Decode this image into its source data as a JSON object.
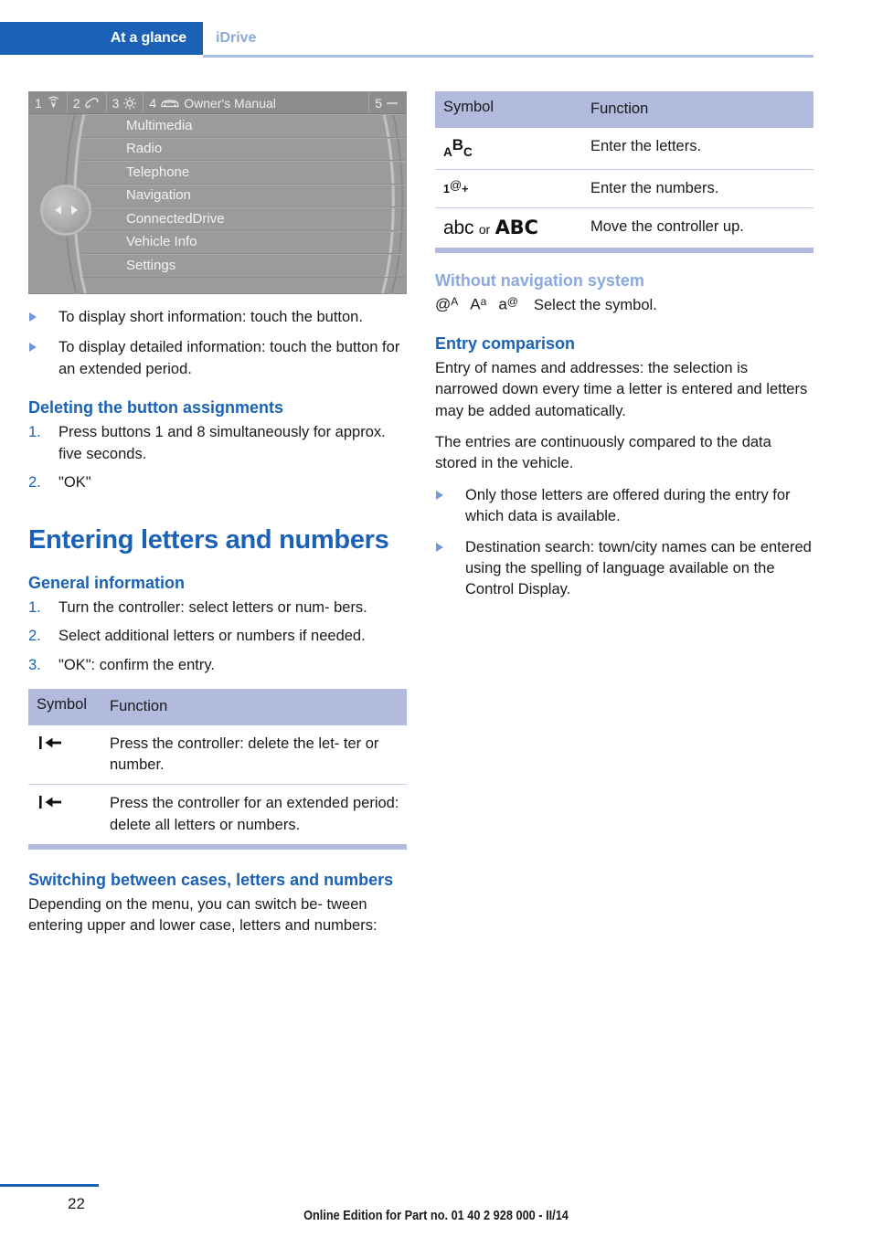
{
  "header": {
    "active_tab": "At a glance",
    "sub_tab": "iDrive"
  },
  "idrive_screenshot": {
    "top_bar": [
      {
        "number": "1",
        "icon": "radio-waves-icon"
      },
      {
        "number": "2",
        "icon": "telephone-handset-icon"
      },
      {
        "number": "3",
        "icon": "gear-icon"
      },
      {
        "number": "4",
        "icon": "car-front-icon",
        "label": "Owner's Manual"
      },
      {
        "number": "5",
        "icon": "minus-icon"
      }
    ],
    "menu_items": [
      "Multimedia",
      "Radio",
      "Telephone",
      "Navigation",
      "ConnectedDrive",
      "Vehicle Info",
      "Settings"
    ]
  },
  "left_column": {
    "bullets_top": [
      "To display short information: touch the button.",
      "To display detailed information: touch the button for an extended period."
    ],
    "deleting_heading": "Deleting the button assignments",
    "deleting_steps": [
      {
        "num": "1.",
        "text": "Press buttons 1 and 8 simultaneously for approx. five seconds."
      },
      {
        "num": "2.",
        "text": "\"OK\""
      }
    ],
    "main_heading": "Entering letters and numbers",
    "general_heading": "General information",
    "general_steps": [
      {
        "num": "1.",
        "text": "Turn the controller: select letters or num- bers."
      },
      {
        "num": "2.",
        "text": "Select additional letters or numbers if needed."
      },
      {
        "num": "3.",
        "text": "\"OK\": confirm the entry."
      }
    ],
    "table": {
      "columns": [
        "Symbol",
        "Function"
      ],
      "rows": [
        {
          "symbol": "backspace-icon",
          "function": "Press the controller: delete the let- ter or number."
        },
        {
          "symbol": "backspace-icon",
          "function": "Press the controller for an extended period: delete all letters or numbers."
        }
      ]
    },
    "switching_heading": "Switching between cases, letters and numbers",
    "switching_para": "Depending on the menu, you can switch be- tween entering upper and lower case, letters and numbers:"
  },
  "right_column": {
    "table": {
      "columns": [
        "Symbol",
        "Function"
      ],
      "rows": [
        {
          "symbol": "ABC",
          "function": "Enter the letters."
        },
        {
          "symbol": "1@+",
          "function": "Enter the numbers."
        },
        {
          "symbol": "abc or ABC",
          "function": "Move the controller up."
        }
      ]
    },
    "without_nav_heading": "Without navigation system",
    "without_nav_symbols": [
      "@A",
      "Aa",
      "a@"
    ],
    "without_nav_text": "Select the symbol.",
    "entry_comparison_heading": "Entry comparison",
    "entry_paragraphs": [
      "Entry of names and addresses: the selection is narrowed down every time a letter is entered and letters may be added automatically.",
      "The entries are continuously compared to the data stored in the vehicle."
    ],
    "entry_bullets": [
      "Only those letters are offered during the entry for which data is available.",
      "Destination search: town/city names can be entered using the spelling of language available on the Control Display."
    ]
  },
  "footer": {
    "page_number": "22",
    "edition": "Online Edition for Part no. 01 40 2 928 000 - II/14"
  },
  "colors": {
    "brand_blue": "#1b62b6",
    "light_blue": "#8aa9dd",
    "table_header": "#b2bade",
    "bullet_marker": "#6f9bd8"
  }
}
